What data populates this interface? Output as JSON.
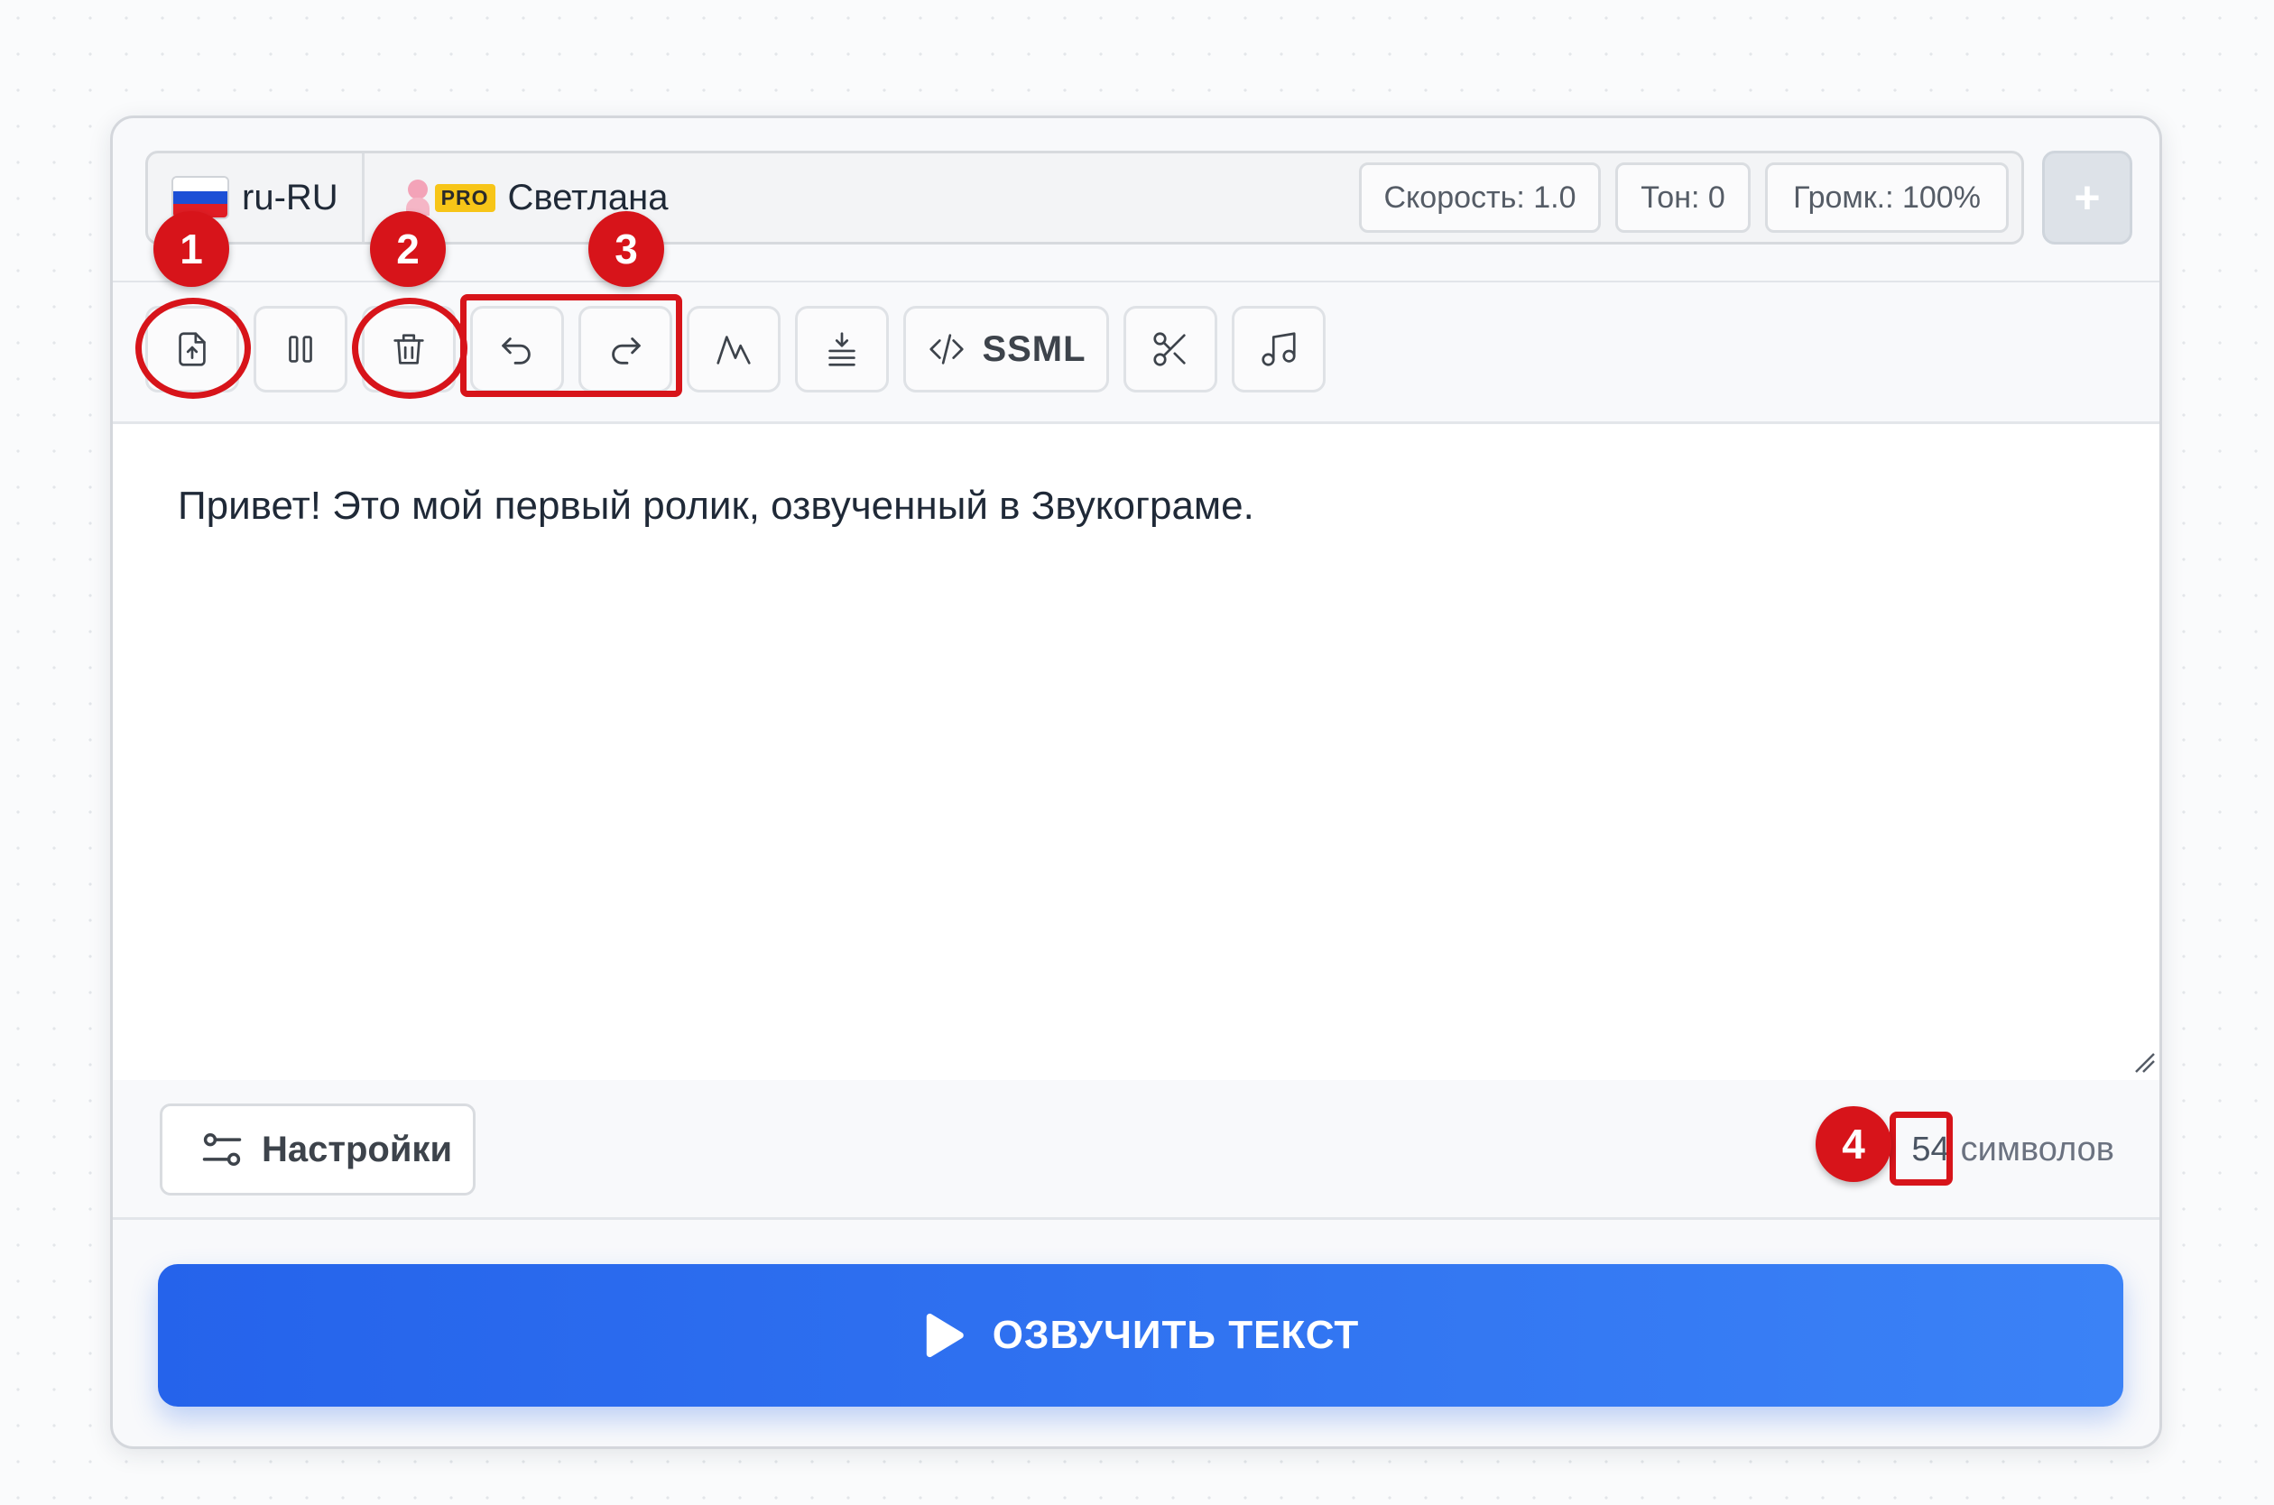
{
  "voice_bar": {
    "language_code": "ru-RU",
    "voice_badge": "PRO",
    "voice_name": "Светлана",
    "speed": "Скорость: 1.0",
    "pitch": "Тон: 0",
    "volume": "Громк.: 100%",
    "add_label": "+"
  },
  "toolbar": {
    "ssml_label": "SSML"
  },
  "editor": {
    "text": "Привет! Это мой первый ролик, озвученный в Звукограме."
  },
  "footer": {
    "settings_label": "Настройки",
    "char_count": "54",
    "char_unit": "символов"
  },
  "action": {
    "speak_label": "ОЗВУЧИТЬ ТЕКСТ"
  },
  "annotations": {
    "badge_1": "1",
    "badge_2": "2",
    "badge_3": "3",
    "badge_4": "4"
  },
  "colors": {
    "accent": "#2563eb",
    "accent_light": "#3b82f6",
    "annotation": "#d7141a",
    "pro_badge": "#f7c518"
  }
}
